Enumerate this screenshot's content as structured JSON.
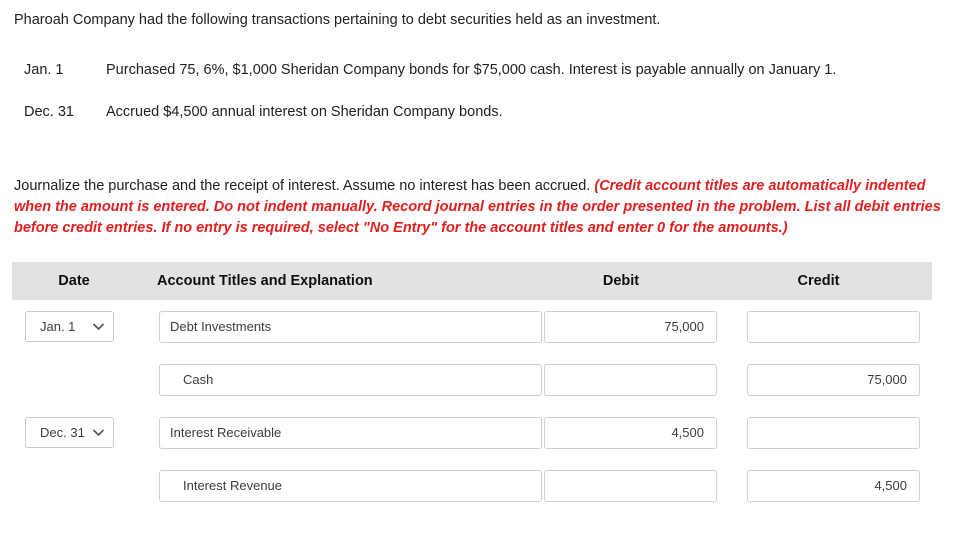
{
  "intro": {
    "text": "Pharoah Company had the following transactions pertaining to debt securities held as an investment."
  },
  "transactions": [
    {
      "date": "Jan. 1",
      "description": "Purchased 75, 6%, $1,000 Sheridan Company bonds for $75,000 cash. Interest is payable annually on January 1."
    },
    {
      "date": "Dec. 31",
      "description": "Accrued $4,500 annual interest on Sheridan Company bonds."
    }
  ],
  "instructions": {
    "black": "Journalize the purchase and the receipt of interest. Assume no interest has been accrued. ",
    "red": "(Credit account titles are automatically indented when the amount is entered. Do not indent manually. Record journal entries in the order presented in the problem. List all debit entries before credit entries. If no entry is required, select \"No Entry\" for the account titles and enter 0 for the amounts.)",
    "red_color": "#e02020"
  },
  "journal": {
    "headers": {
      "date": "Date",
      "account": "Account Titles and Explanation",
      "debit": "Debit",
      "credit": "Credit"
    },
    "header_background": "#e2e2e2",
    "rows": [
      {
        "has_date": true,
        "date": "Jan. 1",
        "account": "Debt Investments",
        "account_indented": false,
        "debit": "75,000",
        "credit": ""
      },
      {
        "has_date": false,
        "date": "",
        "account": "Cash",
        "account_indented": true,
        "debit": "",
        "credit": "75,000"
      },
      {
        "has_date": true,
        "date": "Dec. 31",
        "account": "Interest Receivable",
        "account_indented": false,
        "debit": "4,500",
        "credit": ""
      },
      {
        "has_date": false,
        "date": "",
        "account": "Interest Revenue",
        "account_indented": true,
        "debit": "",
        "credit": "4,500"
      }
    ]
  }
}
